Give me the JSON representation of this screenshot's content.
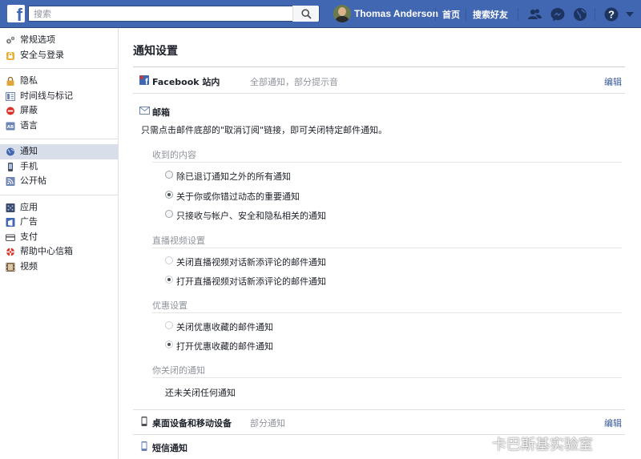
{
  "topbar": {
    "logo": "f",
    "search_placeholder": "搜索",
    "user_name": "Thomas Anderson",
    "home": "首页",
    "find_friends": "搜索好友"
  },
  "sidebar": {
    "groups": [
      [
        {
          "label": "常规选项",
          "icon": "gears-icon"
        },
        {
          "label": "安全与登录",
          "icon": "lock-badge-icon"
        }
      ],
      [
        {
          "label": "隐私",
          "icon": "padlock-icon"
        },
        {
          "label": "时间线与标记",
          "icon": "timeline-icon"
        },
        {
          "label": "屏蔽",
          "icon": "block-icon"
        },
        {
          "label": "语言",
          "icon": "language-icon"
        }
      ],
      [
        {
          "label": "通知",
          "icon": "globe-icon",
          "active": true
        },
        {
          "label": "手机",
          "icon": "mobile-icon"
        },
        {
          "label": "公开帖",
          "icon": "rss-icon"
        }
      ],
      [
        {
          "label": "应用",
          "icon": "apps-icon"
        },
        {
          "label": "广告",
          "icon": "ads-icon"
        },
        {
          "label": "支付",
          "icon": "payment-icon"
        },
        {
          "label": "帮助中心信箱",
          "icon": "help-lifebuoy-icon"
        },
        {
          "label": "视频",
          "icon": "film-icon"
        }
      ]
    ]
  },
  "main": {
    "title": "通知设置",
    "on_facebook": {
      "label": "Facebook 站内",
      "summary": "全部通知，部分提示音",
      "edit": "编辑"
    },
    "email": {
      "label": "邮箱",
      "description": "只需点击邮件底部的\"取消订阅\"链接，即可关闭特定邮件通知。",
      "received": {
        "title": "收到的内容",
        "options": [
          {
            "label": "除已退订通知之外的所有通知",
            "checked": false
          },
          {
            "label": "关于你或你错过动态的重要通知",
            "checked": true
          },
          {
            "label": "只接收与帐户、安全和隐私相关的通知",
            "checked": false
          }
        ]
      },
      "live_video": {
        "title": "直播视频设置",
        "options": [
          {
            "label": "关闭直播视频对话新添评论的邮件通知",
            "checked": false
          },
          {
            "label": "打开直播视频对话新添评论的邮件通知",
            "checked": true
          }
        ]
      },
      "offers": {
        "title": "优惠设置",
        "options": [
          {
            "label": "关闭优惠收藏的邮件通知",
            "checked": false
          },
          {
            "label": "打开优惠收藏的邮件通知",
            "checked": true
          }
        ]
      },
      "turned_off": {
        "title": "你关闭的通知",
        "text": "还未关闭任何通知"
      }
    },
    "desktop_mobile": {
      "label": "桌面设备和移动设备",
      "summary": "部分通知",
      "edit": "编辑"
    },
    "sms": {
      "label": "短信通知"
    }
  },
  "watermark": "卡巴斯基实验室",
  "colors": {
    "topbar": "#4267b2",
    "link": "#365899",
    "active_nav": "#d8dfea"
  }
}
